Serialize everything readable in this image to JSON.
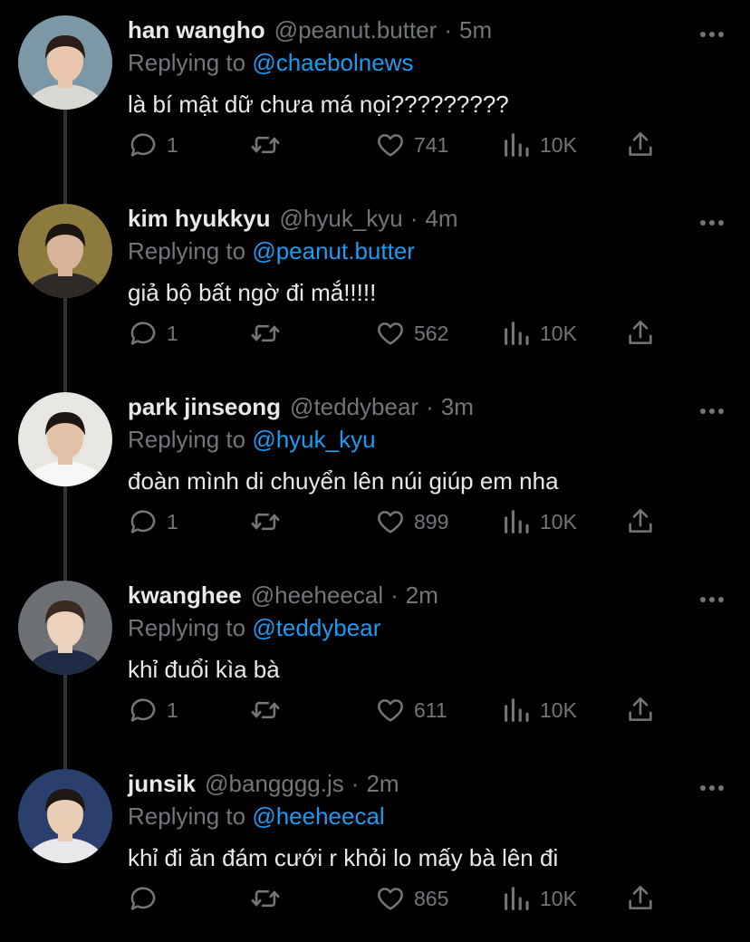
{
  "tweets": [
    {
      "name": "han wangho",
      "handle": "@peanut.butter",
      "separator": "·",
      "time": "5m",
      "replying_prefix": "Replying to",
      "replying_to": "@chaebolnews",
      "text": "là bí mật dữ chưa má nọi?????????",
      "replies": "1",
      "retweets": "",
      "likes": "741",
      "views": "10K",
      "avatar_colors": {
        "bg": "#7c98a6",
        "skin": "#e9c6ad",
        "hair": "#2a1c16",
        "shirt": "#d8d8d4"
      }
    },
    {
      "name": "kim hyukkyu",
      "handle": "@hyuk_kyu",
      "separator": "·",
      "time": "4m",
      "replying_prefix": "Replying to",
      "replying_to": "@peanut.butter",
      "text": "giả bộ bất ngờ đi mắ!!!!!",
      "replies": "1",
      "retweets": "",
      "likes": "562",
      "views": "10K",
      "avatar_colors": {
        "bg": "#8c7a3e",
        "skin": "#d8b59a",
        "hair": "#1a1411",
        "shirt": "#2d2a28"
      }
    },
    {
      "name": "park jinseong",
      "handle": "@teddybear",
      "separator": "·",
      "time": "3m",
      "replying_prefix": "Replying to",
      "replying_to": "@hyuk_kyu",
      "text": "đoàn mình di chuyển lên núi giúp em nha",
      "replies": "1",
      "retweets": "",
      "likes": "899",
      "views": "10K",
      "avatar_colors": {
        "bg": "#e8e6e2",
        "skin": "#e2c1a7",
        "hair": "#1c1714",
        "shirt": "#f7f7f5"
      }
    },
    {
      "name": "kwanghee",
      "handle": "@heeheecal",
      "separator": "·",
      "time": "2m",
      "replying_prefix": "Replying to",
      "replying_to": "@teddybear",
      "text": "khỉ đuổi kìa bà",
      "replies": "1",
      "retweets": "",
      "likes": "611",
      "views": "10K",
      "avatar_colors": {
        "bg": "#6c6f73",
        "skin": "#ecd2bd",
        "hair": "#3a2a20",
        "shirt": "#1d2c44"
      }
    },
    {
      "name": "junsik",
      "handle": "@bangggg.js",
      "separator": "·",
      "time": "2m",
      "replying_prefix": "Replying to",
      "replying_to": "@heeheecal",
      "text": "khỉ đi ăn đám cưới r khỏi lo mấy bà lên đi",
      "replies": "",
      "retweets": "",
      "likes": "865",
      "views": "10K",
      "avatar_colors": {
        "bg": "#2b3f6e",
        "skin": "#ebcdb6",
        "hair": "#1e1714",
        "shirt": "#e8e8ea"
      }
    }
  ],
  "colors": {
    "background": "#000000",
    "text_primary": "#e7e9ea",
    "text_secondary": "#71767b",
    "accent": "#1d9bf0",
    "thread_line": "#2f3336"
  },
  "icons": [
    "more-icon",
    "reply-icon",
    "retweet-icon",
    "like-icon",
    "views-icon",
    "share-icon"
  ]
}
